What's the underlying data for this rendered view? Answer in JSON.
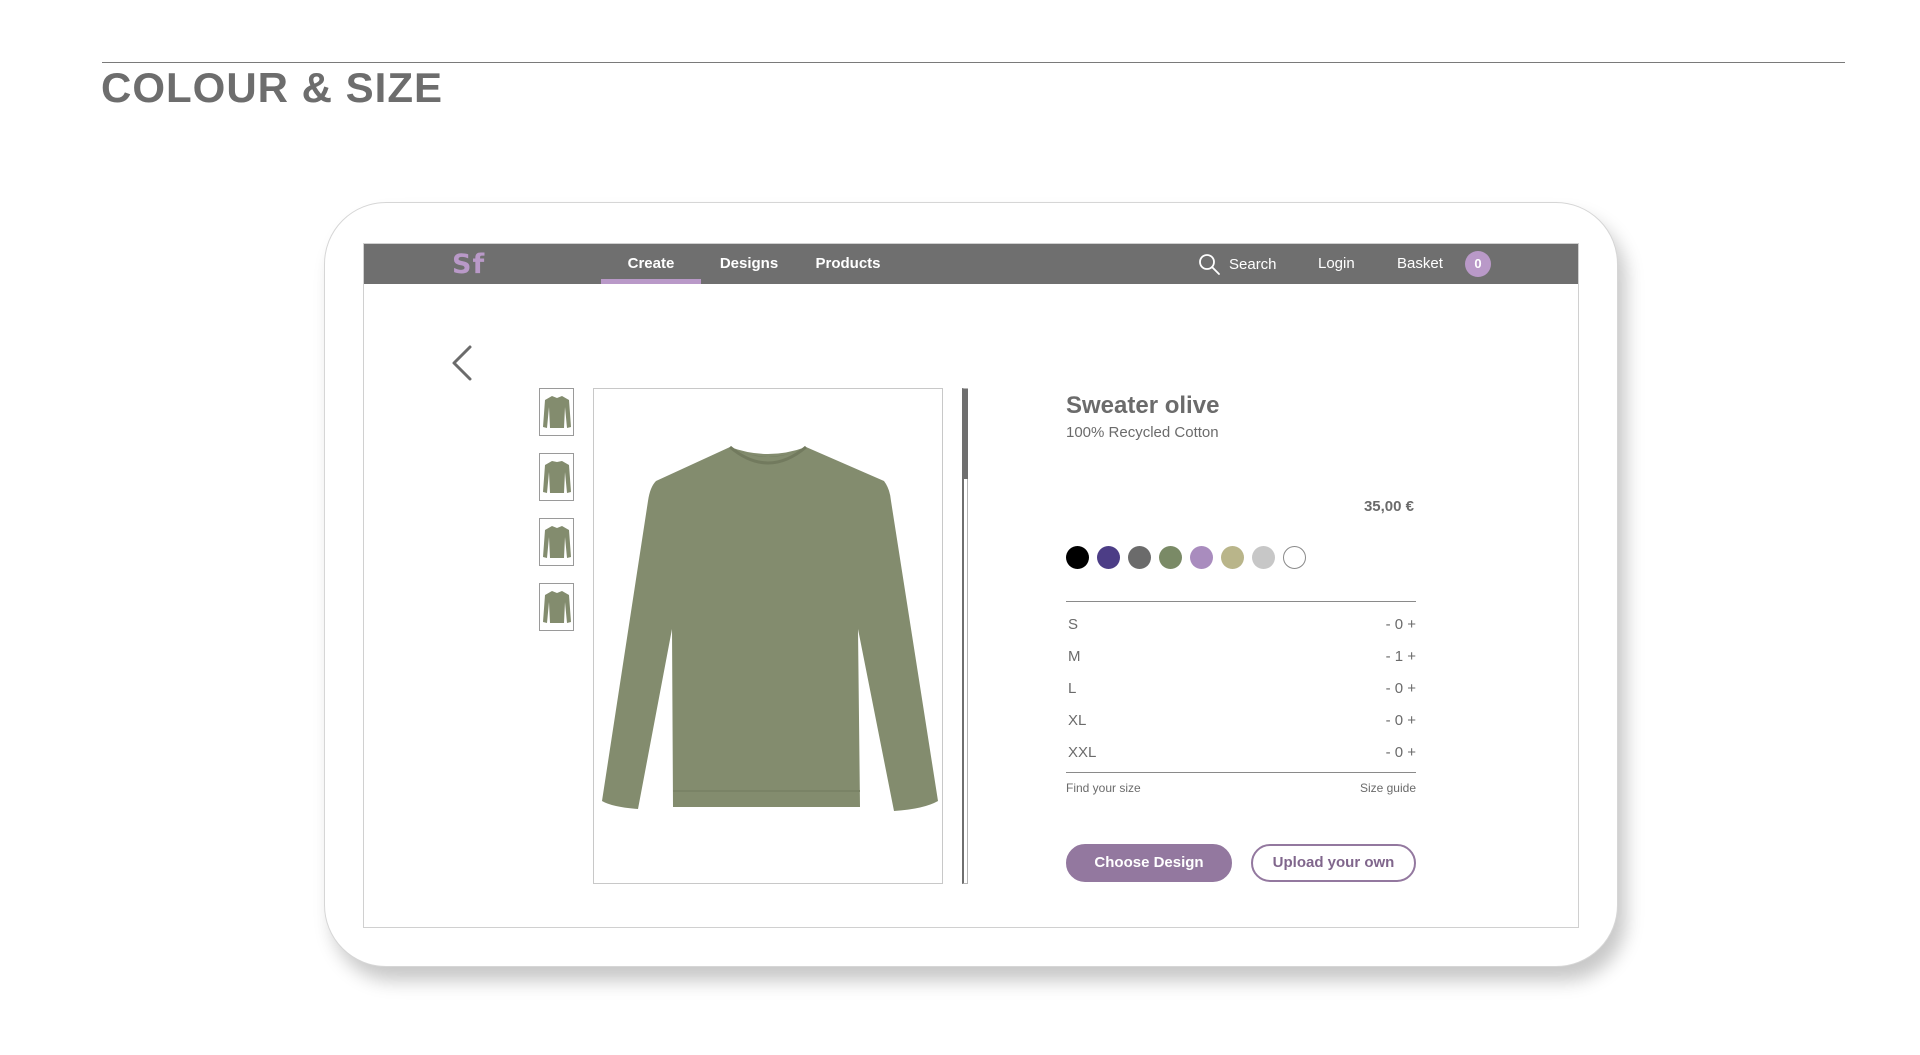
{
  "page": {
    "title": "COLOUR & SIZE"
  },
  "nav": {
    "logo": "Sf",
    "tabs": [
      {
        "label": "Create",
        "active": true
      },
      {
        "label": "Designs",
        "active": false
      },
      {
        "label": "Products",
        "active": false
      }
    ],
    "search_label": "Search",
    "login_label": "Login",
    "basket_label": "Basket",
    "basket_count": "0"
  },
  "product": {
    "name": "Sweater olive",
    "material": "100% Recycled Cotton",
    "price": "35,00 €",
    "image_color": "#838c6e",
    "thumbnail_count": 4
  },
  "colors": [
    {
      "name": "black",
      "hex": "#000000"
    },
    {
      "name": "indigo",
      "hex": "#4c3d86"
    },
    {
      "name": "grey",
      "hex": "#6b6b6b"
    },
    {
      "name": "olive",
      "hex": "#7a8a66"
    },
    {
      "name": "lilac",
      "hex": "#a98cbe"
    },
    {
      "name": "khaki",
      "hex": "#b9b58a"
    },
    {
      "name": "light-grey",
      "hex": "#c7c7c7"
    },
    {
      "name": "white",
      "hex": "#ffffff"
    }
  ],
  "sizes": [
    {
      "label": "S",
      "stepper": "- 0 +"
    },
    {
      "label": "M",
      "stepper": "- 1 +"
    },
    {
      "label": "L",
      "stepper": "- 0 +"
    },
    {
      "label": "XL",
      "stepper": "- 0 +"
    },
    {
      "label": "XXL",
      "stepper": "- 0 +"
    }
  ],
  "size_links": {
    "find": "Find your size",
    "guide": "Size guide"
  },
  "actions": {
    "primary": "Choose Design",
    "secondary": "Upload your own"
  },
  "theme": {
    "accent": "#b999c8",
    "button": "#93789f",
    "nav_bg": "#6f6f6f"
  }
}
